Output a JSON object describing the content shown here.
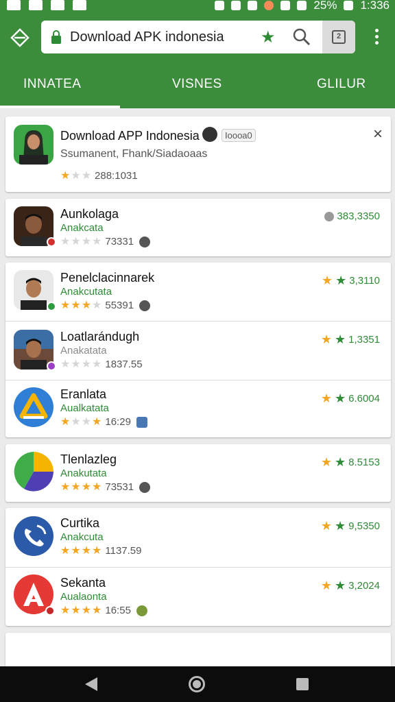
{
  "status_bar": {
    "battery": "25%",
    "time": "1:336"
  },
  "browser": {
    "url_text": "Download APK indonesia",
    "tab_count": "2"
  },
  "tabs": [
    {
      "label": "INNATEA"
    },
    {
      "label": "VISNES"
    },
    {
      "label": "GLILUR"
    }
  ],
  "featured": {
    "title": "Download APP Indonesia",
    "chip": "Ioooa0",
    "subtitle": "Ssumanent, Fhank/Siadaoaas",
    "rating_count": "288:1031",
    "stars_on": 1
  },
  "apps": [
    {
      "title": "Aunkolaga",
      "sub": "Anakcata",
      "count": "73331",
      "meta": "383,3350",
      "stars_on": 0,
      "meta_star": false
    },
    {
      "title": "Penelclacinnarek",
      "sub": "Anakcutata",
      "count": "55391",
      "meta": "3,3110",
      "stars_on": 3,
      "meta_star": true
    },
    {
      "title": "Loatlarándugh",
      "sub": "Anakatata",
      "count": "1837.55",
      "meta": "1,3351",
      "stars_on": 0,
      "meta_star": true
    },
    {
      "title": "Eranlata",
      "sub": "Aualkatata",
      "count": "16:29",
      "meta": "6.6004",
      "stars_on": 1,
      "meta_star": true
    },
    {
      "title": "Tlenlazleg",
      "sub": "Anakutata",
      "count": "73531",
      "meta": "8.5153",
      "stars_on": 4,
      "meta_star": true
    },
    {
      "title": "Curtika",
      "sub": "Anakcuta",
      "count": "1137.59",
      "meta": "9,5350",
      "stars_on": 4,
      "meta_star": true
    },
    {
      "title": "Sekanta",
      "sub": "Aualaonta",
      "count": "16:55",
      "meta": "3,2024",
      "stars_on": 4,
      "meta_star": true
    }
  ],
  "colors": {
    "primary": "#3b8d3c",
    "accent_green": "#2e8b36",
    "star": "#f5a623"
  }
}
